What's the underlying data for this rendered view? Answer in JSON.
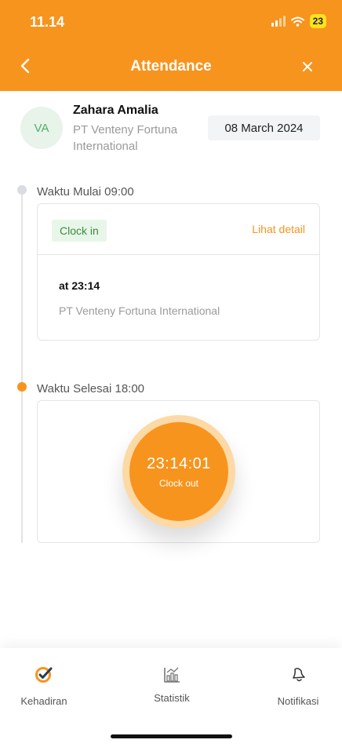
{
  "status_bar": {
    "time": "11.14",
    "battery": "23"
  },
  "nav": {
    "title": "Attendance",
    "back_icon": "chevron-left-icon",
    "close_icon": "close-icon"
  },
  "user": {
    "initials": "VA",
    "name": "Zahara Amalia",
    "company": "PT Venteny Fortuna International",
    "date": "08 March 2024"
  },
  "clock_in": {
    "label": "Waktu Mulai 09:00",
    "badge": "Clock in",
    "detail_link": "Lihat detail",
    "time": "at 23:14",
    "location": "PT Venteny Fortuna International"
  },
  "clock_out": {
    "label": "Waktu Selesai 18:00",
    "timer": "23:14:01",
    "button_label": "Clock out"
  },
  "tabs": [
    {
      "label": "Kehadiran",
      "icon": "check-circle-icon",
      "active": true
    },
    {
      "label": "Statistik",
      "icon": "chart-icon",
      "active": false
    },
    {
      "label": "Notifikasi",
      "icon": "bell-icon",
      "active": false
    }
  ],
  "colors": {
    "primary": "#F7941D",
    "primary_light": "#FDD9A6",
    "success_bg": "#E8F6E9",
    "success_text": "#3B8B3F"
  }
}
